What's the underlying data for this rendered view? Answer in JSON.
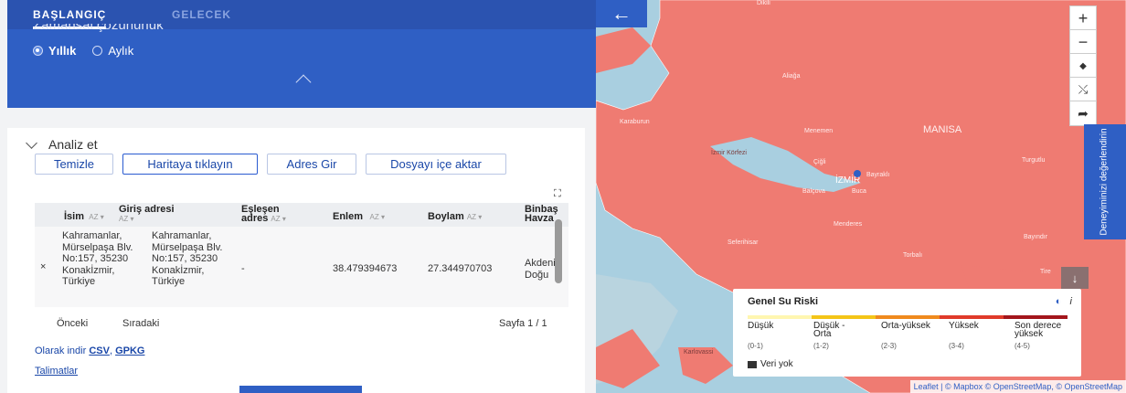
{
  "tabs": {
    "start": "BAŞLANGIÇ",
    "future": "GELECEK"
  },
  "resolution": {
    "label": "Zamansal çözünürlük",
    "options": [
      "Yıllık",
      "Aylık"
    ],
    "selected": "Yıllık"
  },
  "analyze": {
    "title": "Analiz et",
    "buttons": [
      "Temizle",
      "Haritaya tıklayın",
      "Adres Gir",
      "Dosyayı içe aktar"
    ]
  },
  "table": {
    "headers": [
      "İsim",
      "Giriş adresi",
      "Eşleşen adres",
      "Enlem",
      "Boylam",
      "Binbaş Havza"
    ],
    "row": {
      "name": "Kahramanlar, Mürselpaşa Blv. No:157, 35230 Konakİzmir, Türkiye",
      "input_address": "Kahramanlar, Mürselpaşa Blv. No:157, 35230 Konakİzmir, Türkiye",
      "matched": "-",
      "lat": "38.479394673",
      "lon": "27.344970703",
      "basin": "Akdeniz Doğu"
    },
    "remove": "×"
  },
  "pager": {
    "prev": "Önceki",
    "next": "Sıradaki",
    "page": "Sayfa 1 / 1"
  },
  "download": {
    "label": "Olarak indir",
    "csv": "CSV",
    "gpkg": "GPKG"
  },
  "instructions": "Talimatlar",
  "map": {
    "feedback": "Deneyiminizi değerlendirin",
    "places": [
      "Dikili",
      "Aliağa",
      "Karaburun",
      "Menemen",
      "MANISA",
      "Turgutlu",
      "İzmir Körfezi",
      "Çiğli",
      "İZMİR",
      "Bayraklı",
      "Buca",
      "Balçova",
      "Menderes",
      "Seferihisar",
      "Torbalı",
      "Bayındır",
      "Tire",
      "Karlovassi"
    ],
    "legend": {
      "title": "Genel Su Riski",
      "colors": [
        "#fff6b0",
        "#f4c518",
        "#f08a1e",
        "#e03a2a",
        "#a3161c"
      ],
      "labels": [
        "Düşük",
        "Düşük - Orta",
        "Orta-yüksek",
        "Yüksek",
        "Son derece yüksek"
      ],
      "ranges": [
        "(0-1)",
        "(1-2)",
        "(2-3)",
        "(3-4)",
        "(4-5)"
      ],
      "no_data": "Veri yok"
    },
    "attribution": "Leaflet | © Mapbox © OpenStreetMap, © OpenStreetMap"
  }
}
